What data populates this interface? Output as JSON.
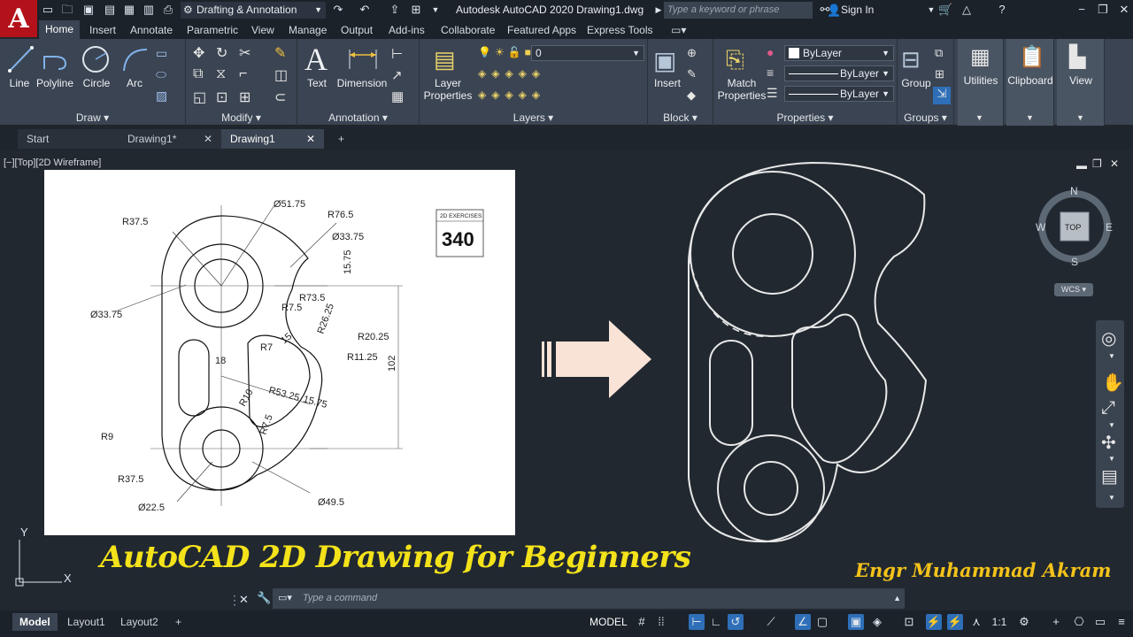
{
  "app": {
    "logo_letter": "A",
    "workspace": "Drafting & Annotation",
    "title": "Autodesk AutoCAD 2020   Drawing1.dwg",
    "search_placeholder": "Type a keyword or phrase",
    "sign_in": "Sign In"
  },
  "ribbon_tabs": [
    "Home",
    "Insert",
    "Annotate",
    "Parametric",
    "View",
    "Manage",
    "Output",
    "Add-ins",
    "Collaborate",
    "Featured Apps",
    "Express Tools"
  ],
  "ribbon": {
    "draw": {
      "label": "Draw",
      "tools": [
        "Line",
        "Polyline",
        "Circle",
        "Arc"
      ]
    },
    "modify": {
      "label": "Modify"
    },
    "annotation": {
      "label": "Annotation",
      "tools": [
        "Text",
        "Dimension"
      ]
    },
    "layers": {
      "label": "Layers",
      "tool": "Layer\nProperties",
      "tool_l1": "Layer",
      "tool_l2": "Properties",
      "current": "0"
    },
    "block": {
      "label": "Block",
      "tool": "Insert"
    },
    "properties": {
      "label": "Properties",
      "tool_l1": "Match",
      "tool_l2": "Properties",
      "color": "ByLayer",
      "linetype": "ByLayer",
      "lineweight": "ByLayer"
    },
    "groups": {
      "label": "Groups",
      "tool": "Group"
    },
    "utilities": "Utilities",
    "clipboard": "Clipboard",
    "view": "View"
  },
  "doc_tabs": [
    "Start",
    "Drawing1*",
    "Drawing1"
  ],
  "viewport": {
    "label": "[−][Top][2D Wireframe]",
    "viewcube": {
      "n": "N",
      "s": "S",
      "e": "E",
      "w": "W",
      "face": "TOP",
      "wcs": "WCS"
    },
    "ucs": {
      "y": "Y",
      "x": "X"
    }
  },
  "reference_drawing": {
    "badge_caption": "2D EXERCISES",
    "badge_number": "340",
    "dims": [
      "Ø51.75",
      "R76.5",
      "R37.5",
      "Ø33.75",
      "15.75",
      "Ø33.75",
      "R73.5",
      "R7.5",
      "R26.25",
      "R20.25",
      "R11.25",
      "R7",
      "15",
      "18",
      "102",
      "R53.25",
      "15.75",
      "R10",
      "R7.5",
      "R9",
      "R37.5",
      "Ø22.5",
      "Ø49.5"
    ]
  },
  "overlay": {
    "title": "AutoCAD 2D Drawing for Beginners",
    "author": "Engr Muhammad Akram"
  },
  "command_line": {
    "placeholder": "Type  a  command"
  },
  "layout_tabs": [
    "Model",
    "Layout1",
    "Layout2"
  ],
  "status": {
    "model": "MODEL",
    "scale": "1:1"
  },
  "colors": {
    "accent_yellow": "#f4e21a",
    "author_yellow": "#f4c21a",
    "arrow_fill": "#f8e3d6",
    "logo_red": "#b4121a"
  }
}
